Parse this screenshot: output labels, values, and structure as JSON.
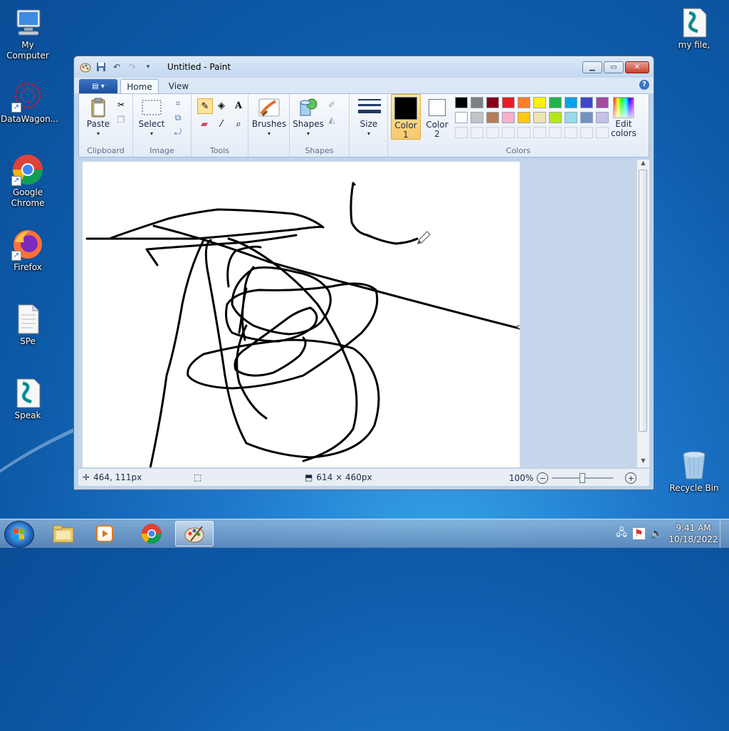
{
  "desktop": {
    "icons": [
      {
        "label": "My Computer"
      },
      {
        "label": "DataWagon..."
      },
      {
        "label": "Google Chrome"
      },
      {
        "label": "Firefox"
      },
      {
        "label": "SPe"
      },
      {
        "label": "Speak"
      },
      {
        "label": "my file,"
      },
      {
        "label": "Recycle Bin"
      }
    ]
  },
  "window": {
    "title": "Untitled - Paint",
    "controls": {
      "minimize": "▁",
      "maximize": "▭",
      "close": "✕"
    }
  },
  "tabs": {
    "file": "▤ ▾",
    "home": "Home",
    "view": "View",
    "help": "?"
  },
  "ribbon": {
    "clipboard": {
      "label": "Clipboard",
      "paste": "Paste"
    },
    "image": {
      "label": "Image",
      "select": "Select"
    },
    "tools": {
      "label": "Tools"
    },
    "brushes": {
      "label": "Brushes"
    },
    "shapes": {
      "label": "Shapes",
      "shapes_btn": "Shapes"
    },
    "size": {
      "label": "Size"
    },
    "colors": {
      "label": "Colors",
      "color1": "Color\n1",
      "color1_a": "Color",
      "color1_b": "1",
      "color2_a": "Color",
      "color2_b": "2",
      "edit_a": "Edit",
      "edit_b": "colors",
      "palette_row1": [
        "#000000",
        "#7f7f7f",
        "#880015",
        "#ed1c24",
        "#ff7f27",
        "#fff200",
        "#22b14c",
        "#00a2e8",
        "#3f48cc",
        "#a349a4"
      ],
      "palette_row2": [
        "#ffffff",
        "#c3c3c3",
        "#b97a57",
        "#ffaec9",
        "#ffc90e",
        "#efe4b0",
        "#b5e61d",
        "#99d9ea",
        "#7092be",
        "#c8bfe7"
      ]
    }
  },
  "status": {
    "cursor_pos": "464, 111px",
    "canvas_size": "614 × 460px",
    "zoom": "100%"
  },
  "taskbar": {
    "time": "9:41 AM",
    "date": "10/18/2022"
  }
}
